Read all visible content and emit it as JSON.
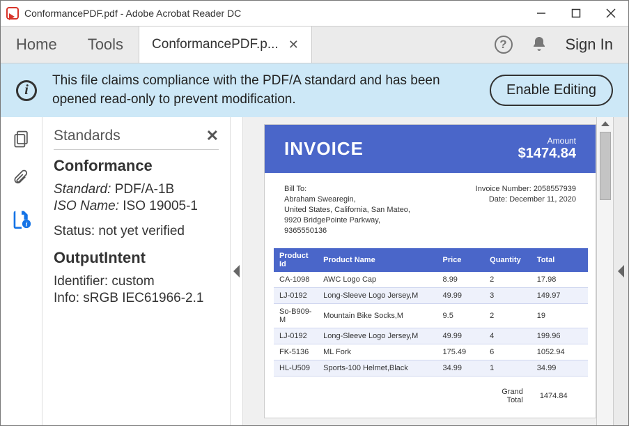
{
  "window": {
    "title": "ConformancePDF.pdf - Adobe Acrobat Reader DC"
  },
  "appbar": {
    "home": "Home",
    "tools": "Tools",
    "tab_label": "ConformancePDF.p...",
    "signin": "Sign In"
  },
  "infobar": {
    "message": "This file claims compliance with the PDF/A standard and has been opened read-only to prevent modification.",
    "button": "Enable Editing"
  },
  "sidepanel": {
    "title": "Standards",
    "h_conformance": "Conformance",
    "standard_label": "Standard:",
    "standard_value": "PDF/A-1B",
    "iso_label": "ISO Name:",
    "iso_value": "ISO 19005-1",
    "status": "Status: not yet verified",
    "h_output": "OutputIntent",
    "identifier": "Identifier: custom",
    "info": "Info: sRGB IEC61966-2.1"
  },
  "invoice": {
    "title": "INVOICE",
    "amount_label": "Amount",
    "amount_value": "$1474.84",
    "bill_to_label": "Bill To:",
    "bill_name": "Abraham Swearegin,",
    "bill_addr1": "United States, California, San Mateo,",
    "bill_addr2": "9920 BridgePointe Parkway,",
    "bill_phone": "9365550136",
    "inv_no": "Invoice Number: 2058557939",
    "inv_date": "Date: December 11, 2020",
    "cols": {
      "c1": "Product Id",
      "c2": "Product Name",
      "c3": "Price",
      "c4": "Quantity",
      "c5": "Total"
    },
    "rows": [
      {
        "id": "CA-1098",
        "name": "AWC Logo Cap",
        "price": "8.99",
        "qty": "2",
        "total": "17.98"
      },
      {
        "id": "LJ-0192",
        "name": "Long-Sleeve Logo Jersey,M",
        "price": "49.99",
        "qty": "3",
        "total": "149.97"
      },
      {
        "id": "So-B909-M",
        "name": "Mountain Bike Socks,M",
        "price": "9.5",
        "qty": "2",
        "total": "19"
      },
      {
        "id": "LJ-0192",
        "name": "Long-Sleeve Logo Jersey,M",
        "price": "49.99",
        "qty": "4",
        "total": "199.96"
      },
      {
        "id": "FK-5136",
        "name": "ML Fork",
        "price": "175.49",
        "qty": "6",
        "total": "1052.94"
      },
      {
        "id": "HL-U509",
        "name": "Sports-100 Helmet,Black",
        "price": "34.99",
        "qty": "1",
        "total": "34.99"
      }
    ],
    "grand_label": "Grand Total",
    "grand_value": "1474.84"
  }
}
